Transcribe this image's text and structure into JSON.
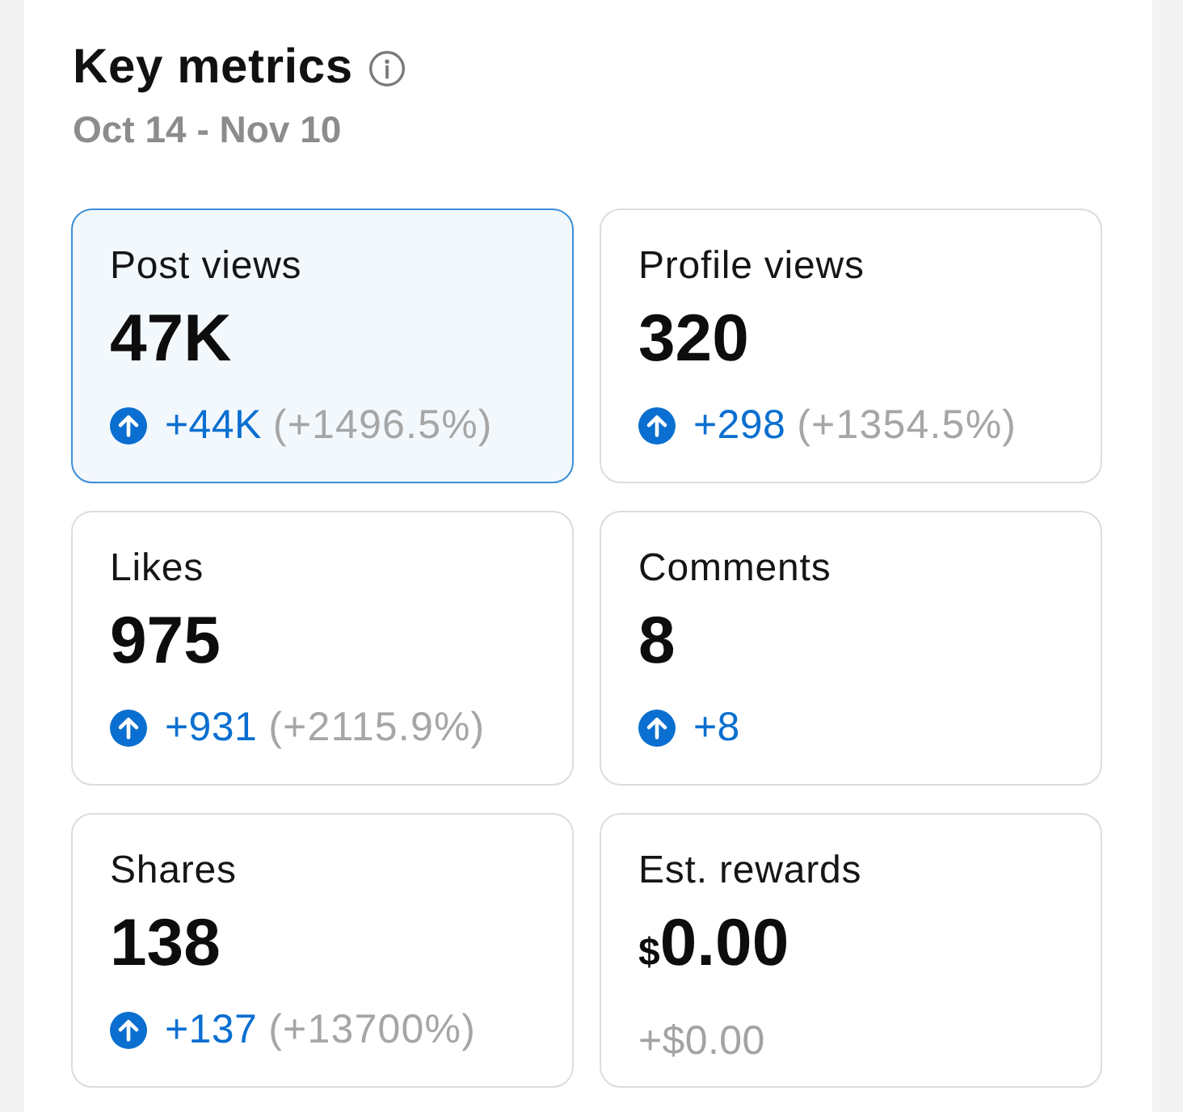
{
  "header": {
    "title": "Key metrics",
    "date_range": "Oct 14 - Nov 10"
  },
  "cards": [
    {
      "label": "Post views",
      "value": "47K",
      "selected": true,
      "change": {
        "rising": true,
        "delta": "+44K",
        "percent": "(+1496.5%)"
      }
    },
    {
      "label": "Profile views",
      "value": "320",
      "selected": false,
      "change": {
        "rising": true,
        "delta": "+298",
        "percent": "(+1354.5%)"
      }
    },
    {
      "label": "Likes",
      "value": "975",
      "selected": false,
      "change": {
        "rising": true,
        "delta": "+931",
        "percent": "(+2115.9%)"
      }
    },
    {
      "label": "Comments",
      "value": "8",
      "selected": false,
      "change": {
        "rising": true,
        "delta": "+8"
      }
    },
    {
      "label": "Shares",
      "value": "138",
      "selected": false,
      "change": {
        "rising": true,
        "delta": "+137",
        "percent": "(+13700%)"
      }
    },
    {
      "label": "Est. rewards",
      "currency": "$",
      "value": "0.00",
      "selected": false,
      "change": {
        "rising": false,
        "delta": "+$0.00"
      }
    }
  ]
}
